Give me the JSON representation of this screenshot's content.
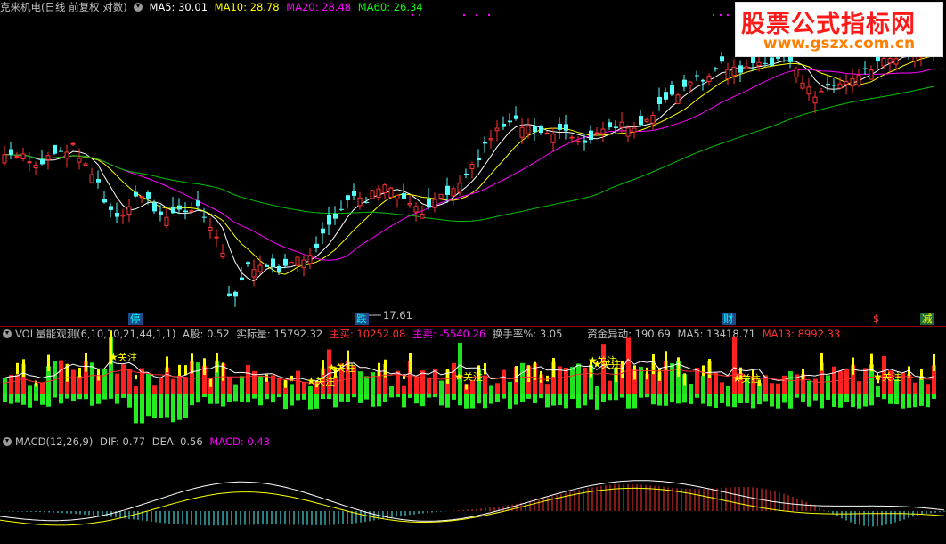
{
  "price_panel": {
    "title": "克来机电(日线 前复权 对数)",
    "ma": [
      {
        "label": "MA5: 30.01",
        "color": "#ffffff"
      },
      {
        "label": "MA10: 28.78",
        "color": "#ffff00"
      },
      {
        "label": "MA20: 28.48",
        "color": "#ff00ff"
      },
      {
        "label": "MA60: 26.34",
        "color": "#00ff00"
      }
    ],
    "low_marker": "17.61",
    "event_labels": [
      {
        "text": "停",
        "color": "#00ffff",
        "bg": "#1e4a8a"
      },
      {
        "text": "跌",
        "color": "#00ffff",
        "bg": "#1e4a8a"
      },
      {
        "text": "财",
        "color": "#00ffff",
        "bg": "#1e4a8a"
      },
      {
        "text": "$",
        "color": "#ff4040",
        "bg": "#000000"
      },
      {
        "text": "减",
        "color": "#ffff00",
        "bg": "#1e6a3a"
      }
    ]
  },
  "watermark": {
    "line1": "股票公式指标网",
    "line2": "www.gszx.com.cn"
  },
  "vol_panel": {
    "title": "VOL量能观测(6,10,10,21,44,1,1)",
    "items": [
      {
        "label": "A股: 0.52",
        "color": "#c0c0c0"
      },
      {
        "label": "实际量: 15792.32",
        "color": "#c0c0c0"
      },
      {
        "label": "主买: 10252.08",
        "color": "#ff3030"
      },
      {
        "label": "主卖: -5540.26",
        "color": "#ff00ff"
      },
      {
        "label": "换手率%: 3.05",
        "color": "#c0c0c0"
      },
      {
        "label": "资金异动: 190.69",
        "color": "#c0c0c0"
      },
      {
        "label": "MA5: 13418.71",
        "color": "#c0c0c0"
      },
      {
        "label": "MA13: 8992.33",
        "color": "#ff3030"
      }
    ],
    "signal_text": "关注",
    "signal_color": "#ffff00"
  },
  "macd_panel": {
    "title": "MACD(12,26,9)",
    "items": [
      {
        "label": "DIF: 0.77",
        "color": "#c0c0c0"
      },
      {
        "label": "DEA: 0.56",
        "color": "#c0c0c0"
      },
      {
        "label": "MACD: 0.43",
        "color": "#ff00ff"
      }
    ]
  },
  "colors": {
    "up": "#ff3232",
    "down": "#54ffff",
    "grid": "#8b0000"
  }
}
